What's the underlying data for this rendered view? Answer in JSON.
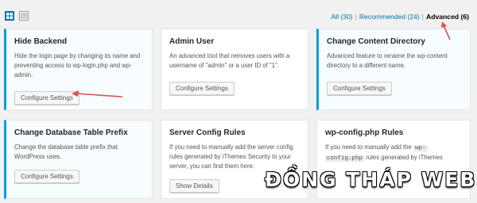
{
  "view_toggle": {
    "grid_icon": "grid-view-icon",
    "list_icon": "list-view-icon"
  },
  "filters": {
    "all": "All (30)",
    "recommended": "Recommended (24)",
    "advanced": "Advanced (6)",
    "separator": "|"
  },
  "cards": [
    {
      "title": "Hide Backend",
      "desc": "Hide the login page by changing its name and preventing access to wp-login.php and wp-admin.",
      "button": "Configure Settings",
      "active": true
    },
    {
      "title": "Admin User",
      "desc": "An advanced tool that removes users with a username of \"admin\" or a user ID of \"1\".",
      "button": "Configure Settings",
      "active": false
    },
    {
      "title": "Change Content Directory",
      "desc": "Advanced feature to rename the wp-content directory to a different name.",
      "button": "Configure Settings",
      "active": true
    },
    {
      "title": "Change Database Table Prefix",
      "desc": "Change the database table prefix that WordPress uses.",
      "button": "Configure Settings",
      "active": true
    },
    {
      "title": "Server Config Rules",
      "desc": "If you need to manually add the server config rules generated by iThemes Security to your server, you can find them here.",
      "button": "Show Details",
      "active": false
    },
    {
      "title": "wp-config.php Rules",
      "desc_pre": "If you need to manually add the",
      "desc_code_1": "wp-",
      "desc_code_2": "config.php",
      "desc_post": "rules generated by iThemes",
      "button": "",
      "active": false
    }
  ],
  "watermark": "ĐỒNG THÁP WEB",
  "colors": {
    "accent": "#00a0d2",
    "link": "#0073aa",
    "arrow": "#d9534f"
  }
}
